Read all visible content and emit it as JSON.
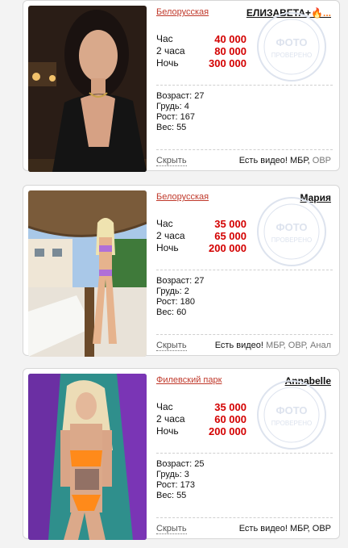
{
  "listings": [
    {
      "district": "Белорусская",
      "name": "ЕЛИЗАВЕТА+",
      "name_suffix": "🔥...",
      "photo_alt": "Фото",
      "stamp_top": "ФОТО",
      "stamp_bottom": "ПРОВЕРЕНО",
      "prices": [
        {
          "label": "Час",
          "value": "40 000"
        },
        {
          "label": "2 часа",
          "value": "80 000"
        },
        {
          "label": "Ночь",
          "value": "300 000"
        }
      ],
      "params": [
        "Возраст: 27",
        "Грудь: 4",
        "Рост: 167",
        "Вес: 55"
      ],
      "hide_label": "Скрыть",
      "video_label": "Есть видео!",
      "services_main": "МБР,",
      "services_muted": "ОВР"
    },
    {
      "district": "Белорусская",
      "name": "Мария",
      "name_suffix": "",
      "photo_alt": "Фото",
      "stamp_top": "ФОТО",
      "stamp_bottom": "ПРОВЕРЕНО",
      "prices": [
        {
          "label": "Час",
          "value": "35 000"
        },
        {
          "label": "2 часа",
          "value": "65 000"
        },
        {
          "label": "Ночь",
          "value": "200 000"
        }
      ],
      "params": [
        "Возраст: 27",
        "Грудь: 2",
        "Рост: 180",
        "Вес: 60"
      ],
      "hide_label": "Скрыть",
      "video_label": "Есть видео!",
      "services_main": "",
      "services_muted": "МБР, ОВР, Анал"
    },
    {
      "district": "Филевский парк",
      "name": "Annabelle",
      "name_suffix": "",
      "photo_alt": "Фото",
      "stamp_top": "ФОТО",
      "stamp_bottom": "ПРОВЕРЕНО",
      "prices": [
        {
          "label": "Час",
          "value": "35 000"
        },
        {
          "label": "2 часа",
          "value": "60 000"
        },
        {
          "label": "Ночь",
          "value": "200 000"
        }
      ],
      "params": [
        "Возраст: 25",
        "Грудь: 3",
        "Рост: 173",
        "Вес: 55"
      ],
      "hide_label": "Скрыть",
      "video_label": "Есть видео!",
      "services_main": "МБР, ОВР",
      "services_muted": ""
    }
  ],
  "colors": {
    "price": "#d30000",
    "district": "#c0392b",
    "stamp": "#dde3ee"
  }
}
